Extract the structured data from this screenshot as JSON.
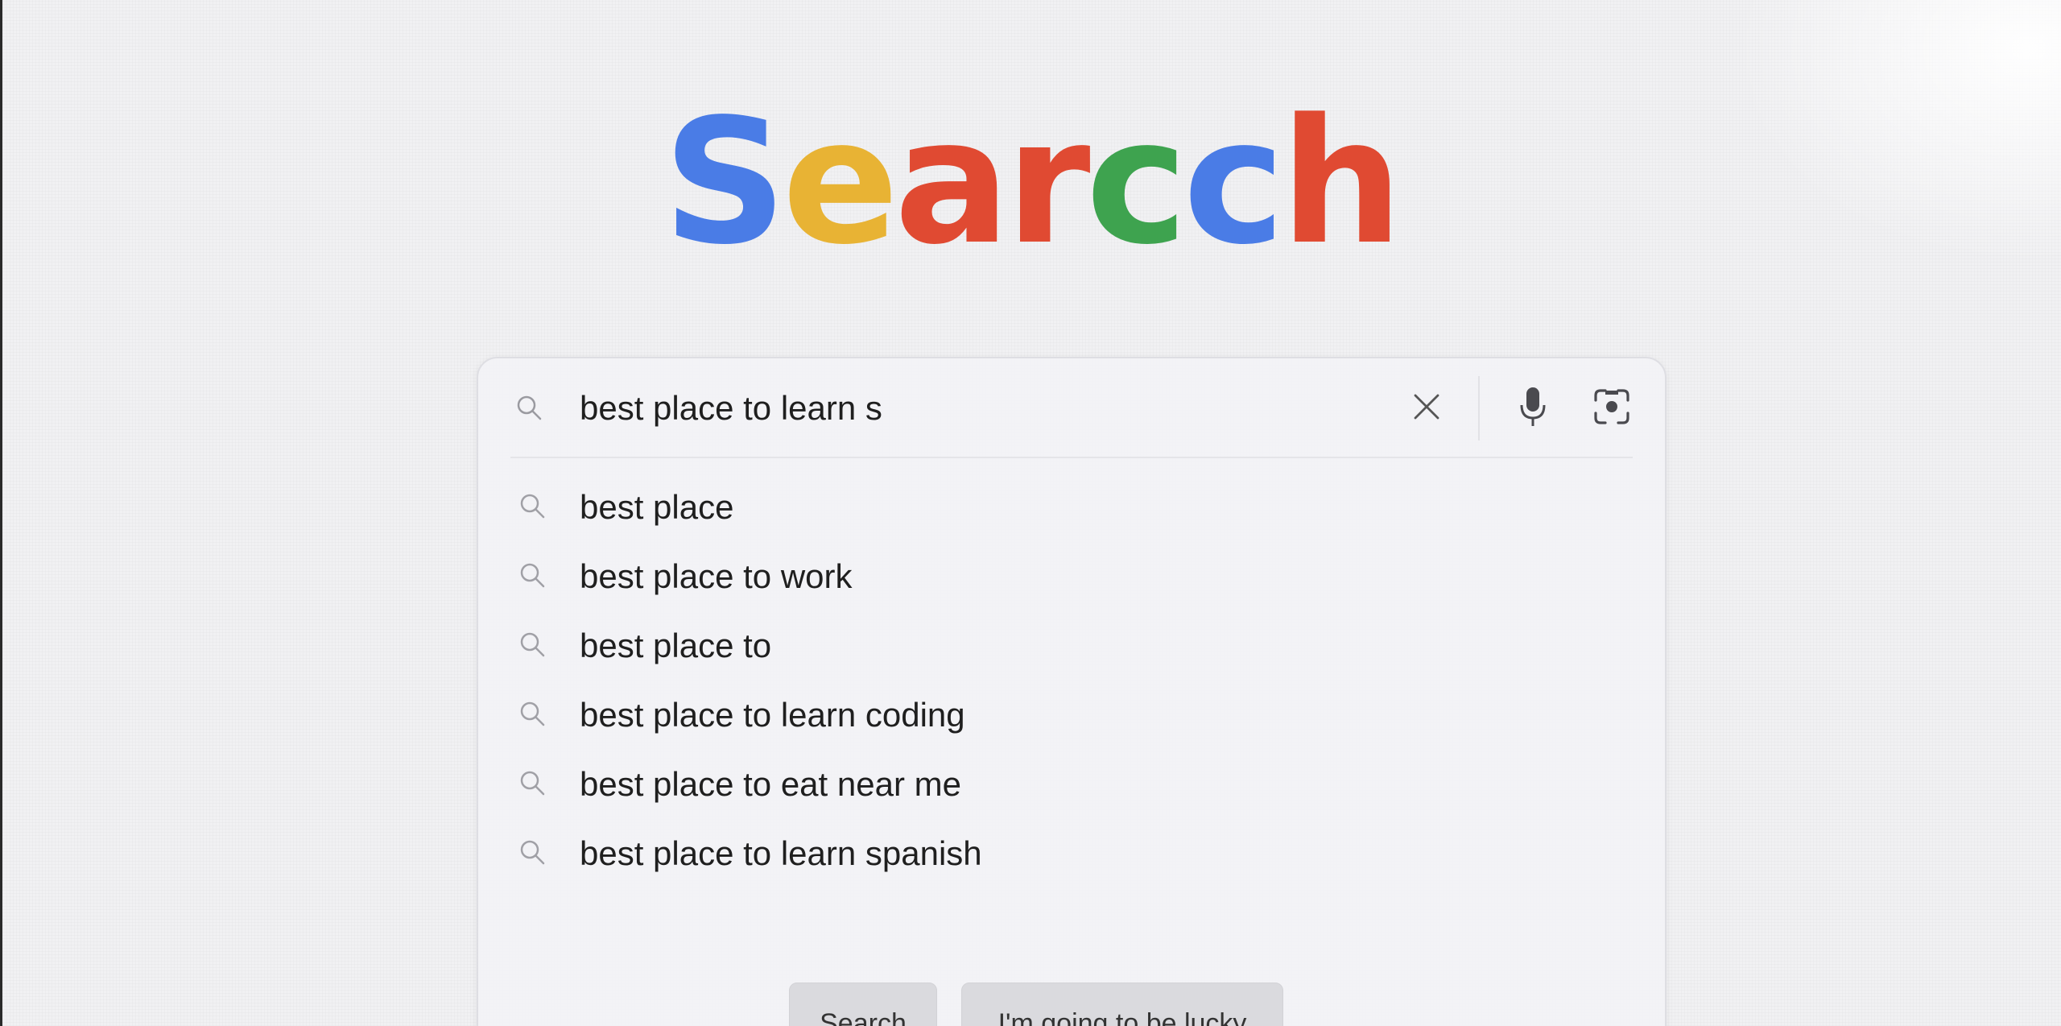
{
  "logo": {
    "letters": [
      {
        "char": "S",
        "color": "#4a7ce6"
      },
      {
        "char": "e",
        "color": "#e8b334"
      },
      {
        "char": "a",
        "color": "#e04a32"
      },
      {
        "char": "r",
        "color": "#e04a32"
      },
      {
        "char": "c",
        "color": "#3ea34f"
      },
      {
        "char": "c",
        "color": "#4a7ce6"
      },
      {
        "char": "h",
        "color": "#e04a32"
      }
    ]
  },
  "search": {
    "query": "best place to learn s",
    "icon": "search-icon",
    "clear_icon": "close-icon",
    "voice_icon": "microphone-icon",
    "lens_icon": "camera-lens-icon"
  },
  "suggestions": [
    {
      "text": "best place",
      "icon": "search-icon"
    },
    {
      "text": "best place to work",
      "icon": "search-icon"
    },
    {
      "text": "best place to",
      "icon": "search-icon"
    },
    {
      "text": "best place to learn coding",
      "icon": "search-icon"
    },
    {
      "text": "best place to eat near me",
      "icon": "search-icon"
    },
    {
      "text": "best place to learn spanish",
      "icon": "search-icon"
    }
  ],
  "buttons": {
    "search_label": "Search",
    "lucky_label": "I'm going to be lucky"
  }
}
